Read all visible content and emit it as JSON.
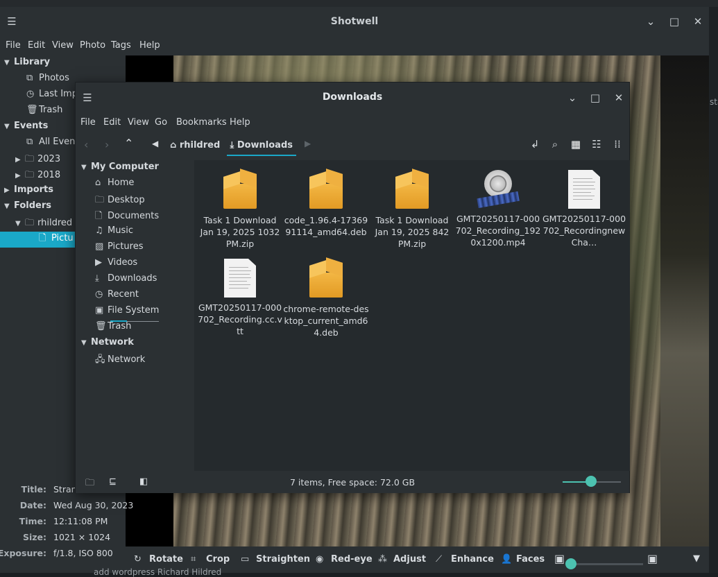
{
  "shotwell": {
    "title": "Shotwell",
    "menu": [
      "File",
      "Edit",
      "View",
      "Photo",
      "Tags",
      "Help"
    ],
    "sidebar": {
      "library": "Library",
      "photos": "Photos",
      "last_import": "Last Imp",
      "trash": "Trash",
      "events": "Events",
      "all_events": "All Event",
      "year_2023": "2023",
      "year_2018": "2018",
      "imports": "Imports",
      "folders": "Folders",
      "folder_user": "rhildred",
      "folder_pictures": "Pictu"
    },
    "metadata": {
      "title_label": "Title:",
      "title_value": "Stran",
      "date_label": "Date:",
      "date_value": "Wed Aug 30, 2023",
      "time_label": "Time:",
      "time_value": "12:11:08 PM",
      "size_label": "Size:",
      "size_value": "1021 × 1024",
      "exposure_label": "Exposure:",
      "exposure_value": "f/1.8, ISO 800"
    },
    "toolbar": {
      "rotate": "Rotate",
      "crop": "Crop",
      "straighten": "Straighten",
      "redeye": "Red-eye",
      "adjust": "Adjust",
      "enhance": "Enhance",
      "faces": "Faces"
    }
  },
  "nemo": {
    "title": "Downloads",
    "menu": [
      "File",
      "Edit",
      "View",
      "Go",
      "Bookmarks",
      "Help"
    ],
    "breadcrumb": {
      "home": "rhildred",
      "current": "Downloads"
    },
    "sidebar": {
      "my_computer": "My Computer",
      "home": "Home",
      "desktop": "Desktop",
      "documents": "Documents",
      "music": "Music",
      "pictures": "Pictures",
      "videos": "Videos",
      "downloads": "Downloads",
      "recent": "Recent",
      "file_system": "File System",
      "trash": "Trash",
      "network_hdr": "Network",
      "network": "Network"
    },
    "files": [
      {
        "name": "Task 1 Download Jan 19, 2025 1032 PM.zip",
        "type": "archive"
      },
      {
        "name": "code_1.96.4-1736991114_amd64.deb",
        "type": "archive"
      },
      {
        "name": "Task 1 Download Jan 19, 2025 842 PM.zip",
        "type": "archive"
      },
      {
        "name": "GMT20250117-000702_Recording_1920x1200.mp4",
        "type": "video"
      },
      {
        "name": "GMT20250117-000702_RecordingnewCha…",
        "type": "text"
      },
      {
        "name": "GMT20250117-000702_Recording.cc.vtt",
        "type": "text"
      },
      {
        "name": "chrome-remote-desktop_current_amd64.deb",
        "type": "archive"
      }
    ],
    "status": "7 items, Free space: 72.0 GB"
  },
  "background": {
    "right_text": "sta",
    "bottom_text": "add wordpress  Richard Hildred"
  },
  "colors": {
    "accent": "#1aa8c8",
    "slider": "#4cc2b0",
    "window_bg": "#2b3033"
  }
}
